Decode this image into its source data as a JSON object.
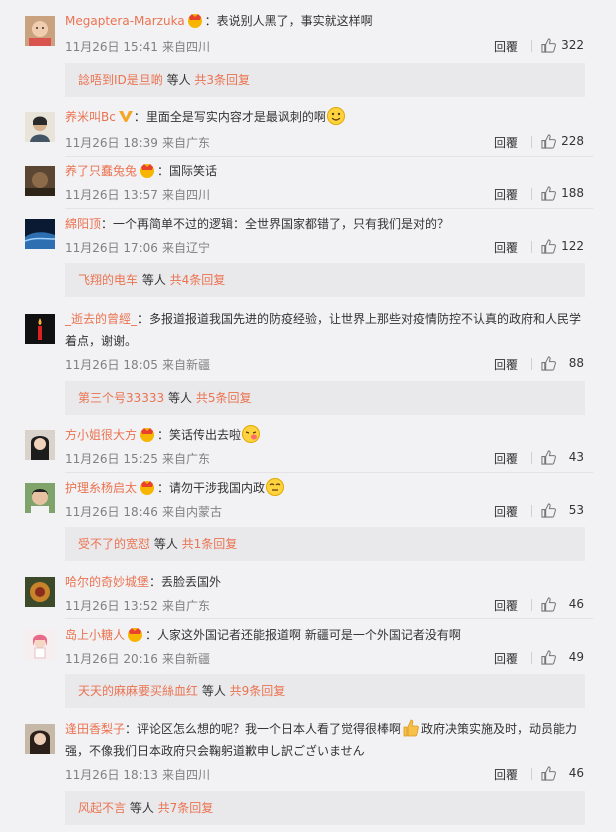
{
  "icon_names": {
    "like": "thumbs-up-icon",
    "verified": "verified-v-icon",
    "emoji": "emoji-face-icon",
    "vip": "vip-crown-icon"
  },
  "colors": {
    "username": "#eb7350",
    "meta": "#808080",
    "subbox_bg": "#e9e9ec",
    "page_bg": "#f2f2f5"
  },
  "comments": [
    {
      "user": "Megaptera-Marzuka",
      "text": "：表说别人黑了，事实就这样啊",
      "time": "11月26日 15:41",
      "source": "来自四川",
      "reply": "回覆",
      "likes": "322",
      "sub": {
        "name": "諗唔到ID是旦啲",
        "mid": " 等人 ",
        "total": "共3条回复"
      }
    },
    {
      "user": "养米叫Bc",
      "text": "：里面全是写实内容才是最讽刺的啊",
      "time": "11月26日 18:39",
      "source": "来自广东",
      "reply": "回覆",
      "likes": "228"
    },
    {
      "user": "养了只蠢兔兔",
      "text": "：国际笑话",
      "time": "11月26日 13:57",
      "source": "来自四川",
      "reply": "回覆",
      "likes": "188"
    },
    {
      "user": "綿阳顶",
      "text": "：一个再简单不过的逻辑：全世界国家都错了，只有我们是对的？",
      "time": "11月26日 17:06",
      "source": "来自辽宁",
      "reply": "回覆",
      "likes": "122",
      "sub": {
        "name": "飞翔的电车",
        "mid": " 等人 ",
        "total": "共4条回复"
      }
    },
    {
      "user": "_逝去的曾經_",
      "text": "：多报道报道我国先进的防疫经验，让世界上那些对疫情防控不认真的政府和人民学着点，谢谢。",
      "time": "11月26日 18:05",
      "source": "来自新疆",
      "reply": "回覆",
      "likes": "88",
      "sub": {
        "name": "第三个号33333",
        "mid": " 等人 ",
        "total": "共5条回复"
      }
    },
    {
      "user": "方小姐很大方",
      "text": "：笑话传出去啦",
      "time": "11月26日 15:25",
      "source": "来自广东",
      "reply": "回覆",
      "likes": "43"
    },
    {
      "user": "护理糸杨启太",
      "text": "：请勿干涉我国内政",
      "time": "11月26日 18:46",
      "source": "来自内蒙古",
      "reply": "回覆",
      "likes": "53",
      "sub": {
        "name": "受不了的宽怼",
        "mid": " 等人 ",
        "total": "共1条回复"
      }
    },
    {
      "user": "哈尔的奇妙城堡",
      "text": "：丢脸丢国外",
      "time": "11月26日 13:52",
      "source": "来自广东",
      "reply": "回覆",
      "likes": "46"
    },
    {
      "user": "岛上小糖人",
      "text": "：人家这外国记者还能报道啊 新疆可是一个外国记者没有啊",
      "time": "11月26日 20:16",
      "source": "来自新疆",
      "reply": "回覆",
      "likes": "49",
      "sub": {
        "name": "天天的麻麻要买絲血红",
        "mid": " 等人 ",
        "total": "共9条回复"
      }
    },
    {
      "user": "逢田香梨子",
      "text": "：评论区怎么想的呢？我一个日本人看了觉得很棒啊",
      "text2": "政府决策实施及时，动员能力强，不像我们日本政府只会鞠躬道歉申し訳ございません",
      "time": "11月26日 18:13",
      "source": "来自四川",
      "reply": "回覆",
      "likes": "46",
      "sub": {
        "name": "风起不言",
        "mid": " 等人 ",
        "total": "共7条回复"
      }
    }
  ]
}
